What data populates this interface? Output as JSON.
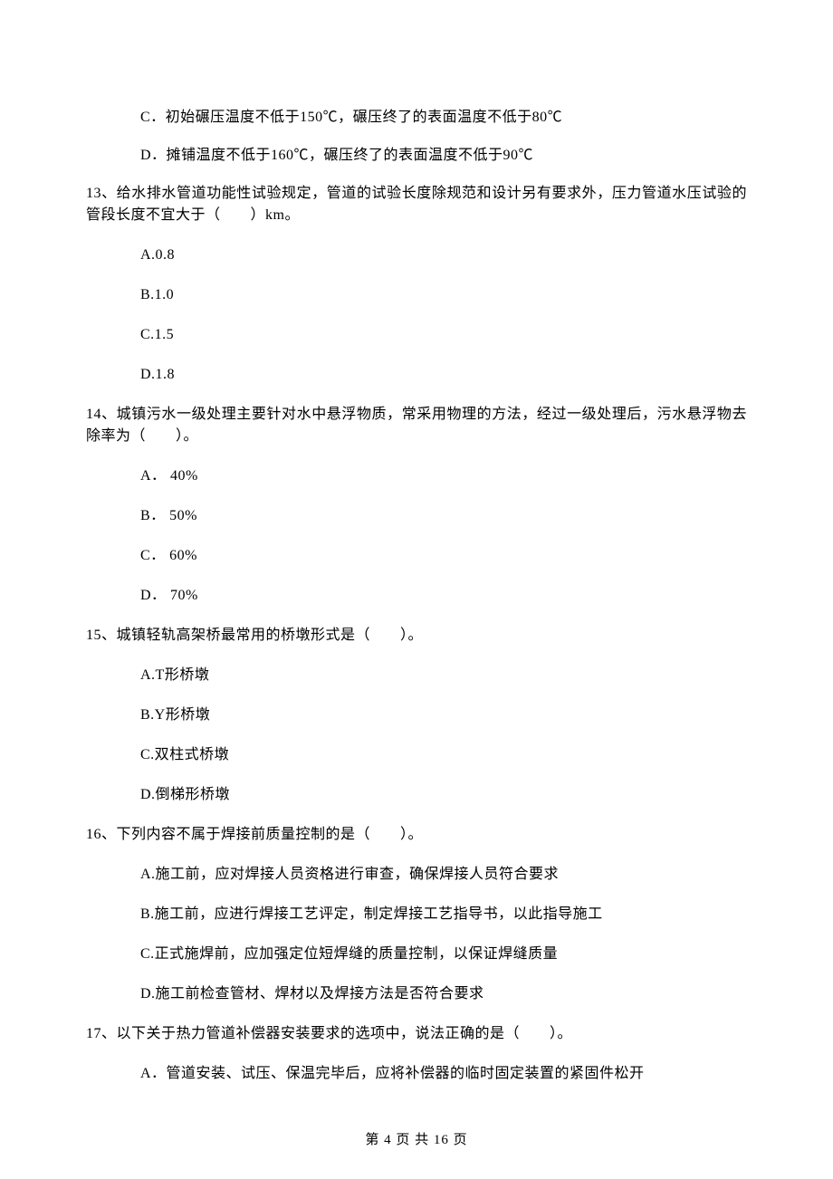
{
  "partial": {
    "optC": "C．初始碾压温度不低于150℃，碾压终了的表面温度不低于80℃",
    "optD": "D．摊铺温度不低于160℃，碾压终了的表面温度不低于90℃"
  },
  "q13": {
    "stem": "13、给水排水管道功能性试验规定，管道的试验长度除规范和设计另有要求外，压力管道水压试验的管段长度不宜大于（　　）km。",
    "A": "A.0.8",
    "B": "B.1.0",
    "C": "C.1.5",
    "D": "D.1.8"
  },
  "q14": {
    "stem": "14、城镇污水一级处理主要针对水中悬浮物质，常采用物理的方法，经过一级处理后，污水悬浮物去除率为（　　）。",
    "A": "A． 40%",
    "B": "B． 50%",
    "C": "C． 60%",
    "D": "D． 70%"
  },
  "q15": {
    "stem": "15、城镇轻轨高架桥最常用的桥墩形式是（　　）。",
    "A": "A.T形桥墩",
    "B": "B.Y形桥墩",
    "C": "C.双柱式桥墩",
    "D": "D.倒梯形桥墩"
  },
  "q16": {
    "stem": "16、下列内容不属于焊接前质量控制的是（　　）。",
    "A": "A.施工前，应对焊接人员资格进行审查，确保焊接人员符合要求",
    "B": "B.施工前，应进行焊接工艺评定，制定焊接工艺指导书，以此指导施工",
    "C": "C.正式施焊前，应加强定位短焊缝的质量控制，以保证焊缝质量",
    "D": "D.施工前检查管材、焊材以及焊接方法是否符合要求"
  },
  "q17": {
    "stem": "17、以下关于热力管道补偿器安装要求的选项中，说法正确的是（　　）。",
    "A": "A．管道安装、试压、保温完毕后，应将补偿器的临时固定装置的紧固件松开"
  },
  "footer": "第 4 页 共 16 页"
}
